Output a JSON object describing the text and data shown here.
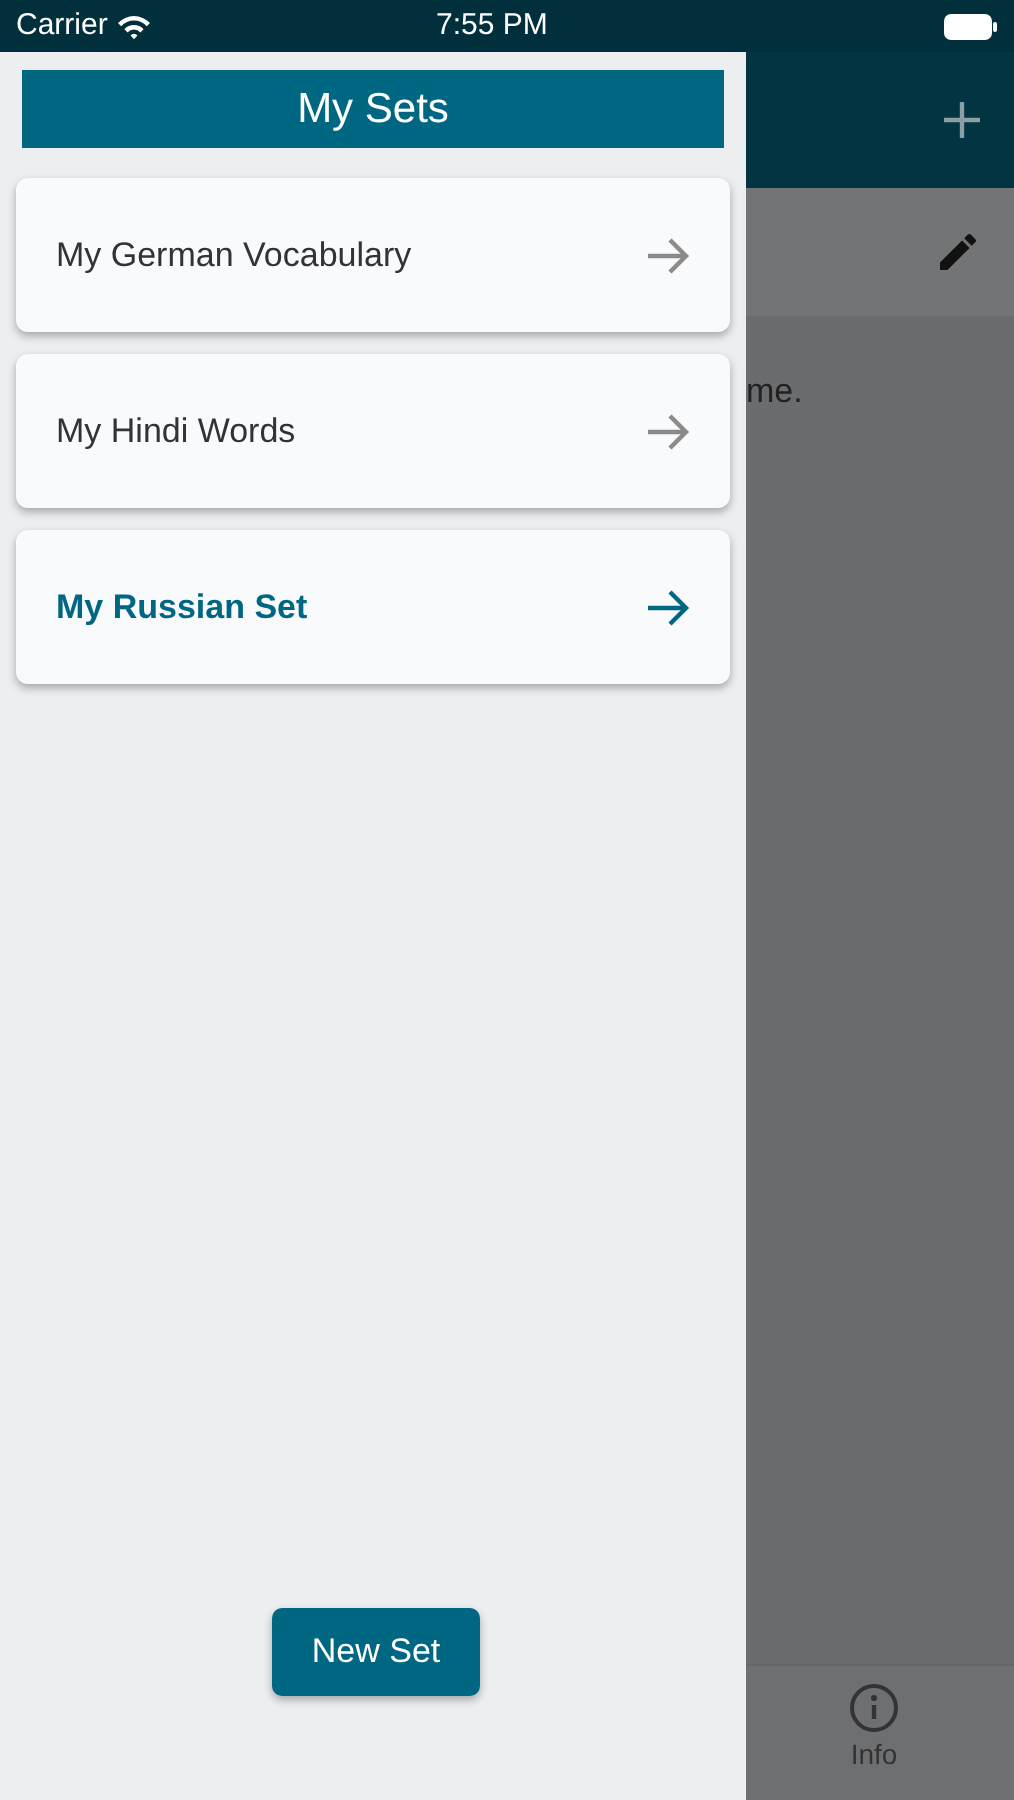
{
  "status_bar": {
    "carrier": "Carrier",
    "time": "7:55 PM"
  },
  "background_screen": {
    "body_text": "me.",
    "tab_bar": [
      {
        "label": "Info"
      }
    ]
  },
  "drawer": {
    "title": "My Sets",
    "sets": [
      {
        "name": "My German Vocabulary",
        "selected": false
      },
      {
        "name": "My Hindi Words",
        "selected": false
      },
      {
        "name": "My Russian Set",
        "selected": true
      }
    ],
    "new_set_button": "New Set"
  }
}
